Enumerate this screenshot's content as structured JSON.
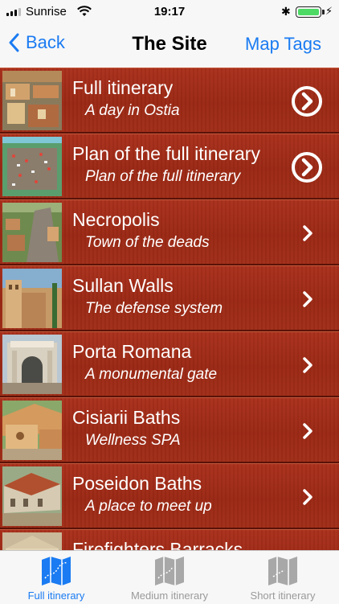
{
  "status": {
    "carrier": "Sunrise",
    "time": "19:17",
    "battery_color": "#4cd964"
  },
  "nav": {
    "back_label": "Back",
    "title": "The Site",
    "right_label": "Map Tags",
    "accent": "#1a7bf2"
  },
  "items": [
    {
      "title": "Full itinerary",
      "subtitle": "A day in Ostia",
      "accessory": "circle-chevron-icon"
    },
    {
      "title": "Plan of the full itinerary",
      "subtitle": "Plan of the full itinerary",
      "accessory": "circle-chevron-icon"
    },
    {
      "title": "Necropolis",
      "subtitle": "Town of the deads",
      "accessory": "chevron-right-icon"
    },
    {
      "title": "Sullan Walls",
      "subtitle": "The defense system",
      "accessory": "chevron-right-icon"
    },
    {
      "title": "Porta Romana",
      "subtitle": "A monumental gate",
      "accessory": "chevron-right-icon"
    },
    {
      "title": "Cisiarii Baths",
      "subtitle": "Wellness SPA",
      "accessory": "chevron-right-icon"
    },
    {
      "title": "Poseidon Baths",
      "subtitle": "A place to meet up",
      "accessory": "chevron-right-icon"
    },
    {
      "title": "Firefighters Barracks",
      "subtitle": "",
      "accessory": "chevron-right-icon"
    }
  ],
  "tabs": [
    {
      "label": "Full itinerary",
      "active": true
    },
    {
      "label": "Medium itinerary",
      "active": false
    },
    {
      "label": "Short itinerary",
      "active": false
    }
  ],
  "row_color": "#9a2814"
}
